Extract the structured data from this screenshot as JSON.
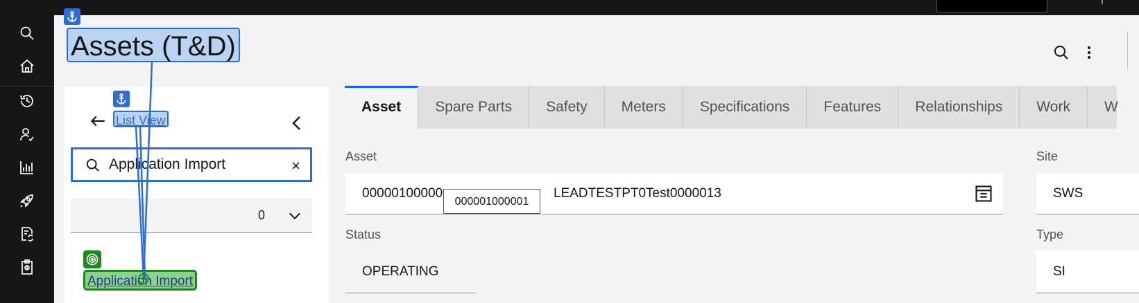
{
  "header": {
    "title": "Assets (T&D)"
  },
  "left_panel": {
    "list_view_label": "List View",
    "search": {
      "value": "Application Import",
      "clear_glyph": "×"
    },
    "filter": {
      "count": "0"
    },
    "result_link": "Application Import"
  },
  "tabs": [
    {
      "label": "Asset",
      "active": true
    },
    {
      "label": "Spare Parts"
    },
    {
      "label": "Safety"
    },
    {
      "label": "Meters"
    },
    {
      "label": "Specifications"
    },
    {
      "label": "Features"
    },
    {
      "label": "Relationships"
    },
    {
      "label": "Work"
    },
    {
      "label": "W"
    }
  ],
  "form": {
    "asset_label": "Asset",
    "asset_value": "00000100000",
    "asset_tooltip": "000001000001",
    "asset_description": "LEADTESTPT0Test0000013",
    "site_label": "Site",
    "site_value": "SWS",
    "status_label": "Status",
    "status_value": "OPERATING",
    "type_label": "Type",
    "type_value": "SI"
  },
  "colors": {
    "nav_bg": "#161616",
    "accent": "#0f62fe",
    "annotation_blue": "#2b6fd6",
    "annotation_green": "#1b8a1b"
  },
  "icons": [
    "search-icon",
    "home-icon",
    "history-icon",
    "user-check-icon",
    "chart-icon",
    "rocket-icon",
    "document-sync-icon",
    "clipboard-icon",
    "anchor-icon",
    "target-icon",
    "overflow-menu-icon",
    "arrow-left-icon",
    "chevron-left-icon",
    "chevron-down-icon",
    "close-icon",
    "lookup-icon"
  ]
}
